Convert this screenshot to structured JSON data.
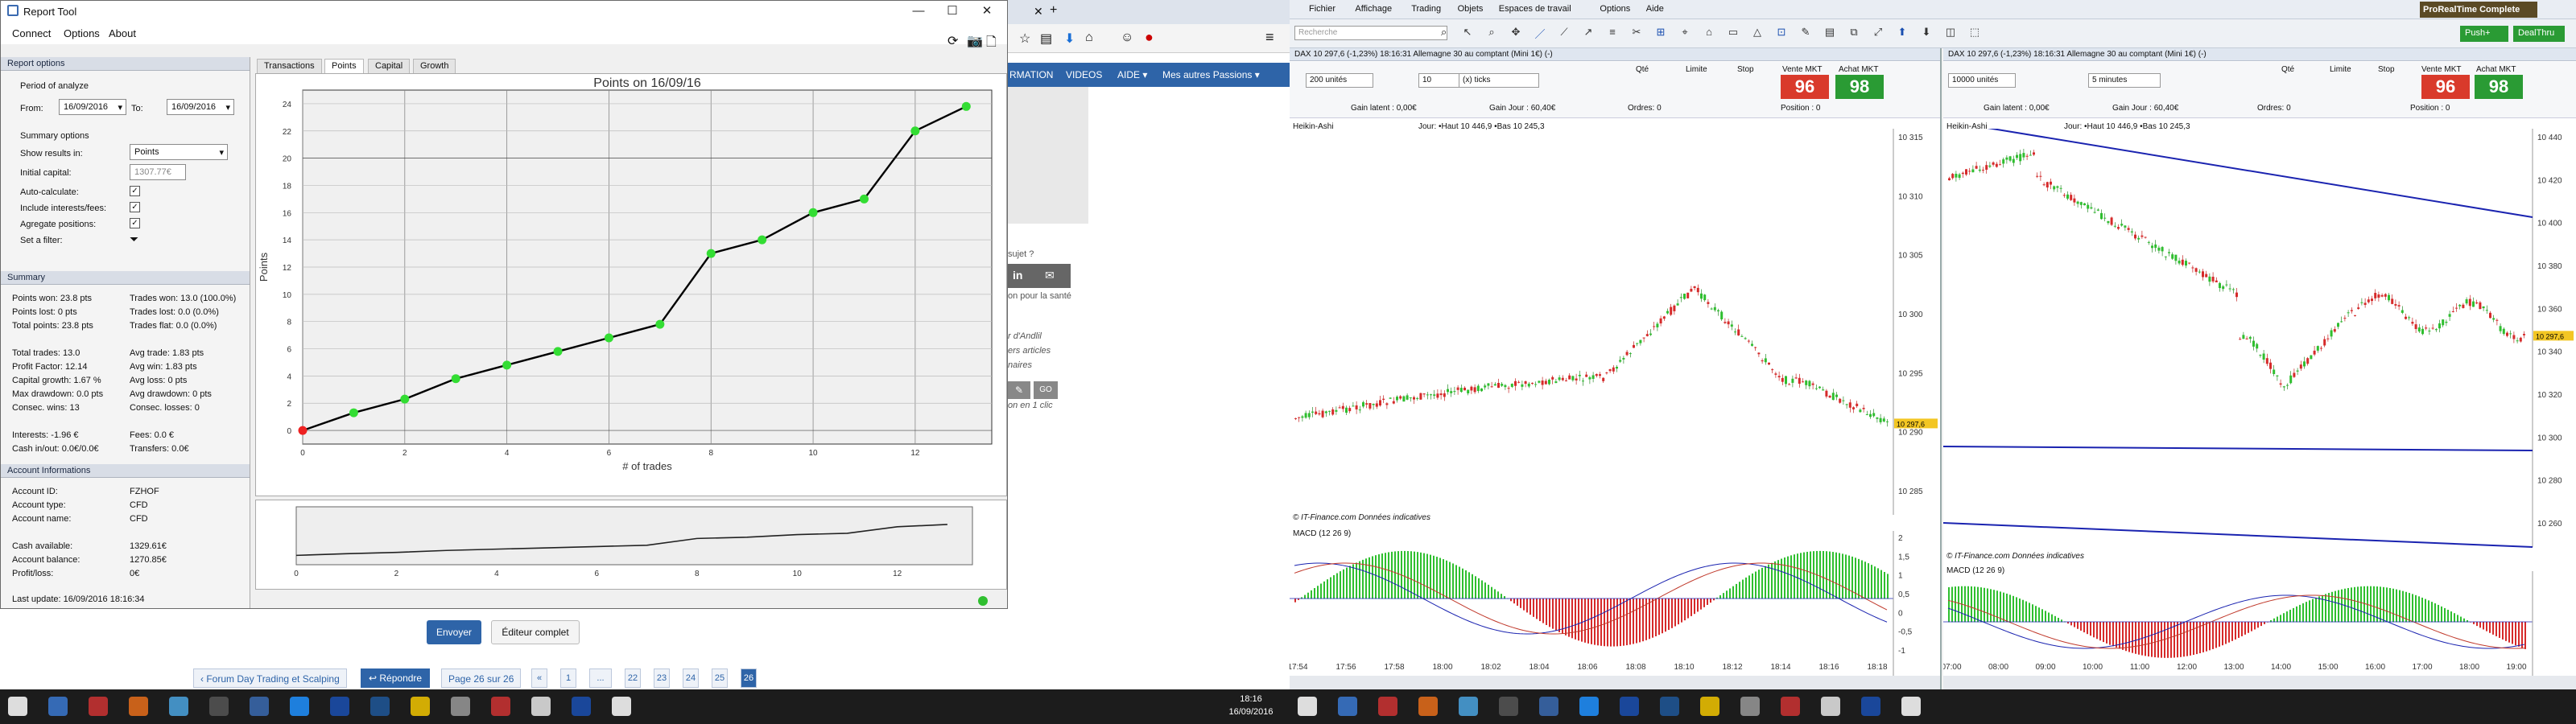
{
  "report": {
    "title": "Report Tool",
    "menu": [
      "Connect",
      "Options",
      "About"
    ],
    "report_options": "Report options",
    "period_label": "Period of analyze",
    "from_label": "From:",
    "from_value": "16/09/2016",
    "to_label": "To:",
    "to_value": "16/09/2016",
    "summary_options": "Summary options",
    "show_results_label": "Show results in:",
    "show_results_value": "Points",
    "initial_capital_label": "Initial capital:",
    "initial_capital_value": "1307.77€",
    "auto_calc": "Auto-calculate:",
    "include_interests": "Include interests/fees:",
    "aggregate": "Agregate positions:",
    "filter": "Set a filter:",
    "summary_title": "Summary",
    "summary_left": [
      "Points won: 23.8 pts",
      "Points lost: 0 pts",
      "Total points: 23.8 pts",
      "",
      "Total trades: 13.0",
      "Profit Factor: 12.14",
      "Capital growth: 1.67 %",
      "Max drawdown: 0.0 pts",
      "Consec. wins: 13",
      "",
      "Interests: -1.96 €",
      "Cash in/out: 0.0€/0.0€"
    ],
    "summary_right": [
      "Trades won: 13.0 (100.0%)",
      "Trades lost: 0.0 (0.0%)",
      "Trades flat: 0.0 (0.0%)",
      "",
      "Avg trade: 1.83 pts",
      "Avg win: 1.83 pts",
      "Avg loss: 0 pts",
      "Avg drawdown: 0 pts",
      "Consec. losses: 0",
      "",
      "Fees: 0.0 €",
      "Transfers: 0.0€"
    ],
    "account_title": "Account Informations",
    "account": [
      [
        "Account ID:",
        "FZHOF"
      ],
      [
        "Account type:",
        "CFD"
      ],
      [
        "Account name:",
        "CFD"
      ],
      [
        "",
        ""
      ],
      [
        "Cash available:",
        "1329.61€"
      ],
      [
        "Account balance:",
        "1270.85€"
      ],
      [
        "Profit/loss:",
        "0€"
      ]
    ],
    "last_update": "Last update: 16/09/2016 18:16:34",
    "tabs": [
      "Transactions",
      "Points",
      "Capital",
      "Growth"
    ],
    "chart_title": "Points on 16/09/16",
    "xlabel": "# of trades",
    "ylabel": "Points"
  },
  "chart_data": {
    "type": "line",
    "title": "Points on 16/09/16",
    "xlabel": "# of trades",
    "ylabel": "Points",
    "x": [
      0,
      1,
      2,
      3,
      4,
      5,
      6,
      7,
      8,
      9,
      10,
      11,
      12,
      13
    ],
    "values": [
      0,
      1.3,
      2.3,
      3.8,
      4.8,
      5.8,
      6.8,
      7.8,
      13,
      14,
      16,
      17,
      22,
      23.8
    ],
    "xlim": [
      0,
      13.5
    ],
    "ylim": [
      -1,
      25
    ],
    "xticks": [
      0,
      2,
      4,
      6,
      8,
      10,
      12
    ],
    "yticks": [
      0,
      2,
      4,
      6,
      8,
      10,
      12,
      14,
      16,
      18,
      20,
      22,
      24
    ],
    "line_color": "#000000",
    "point_color": "#33dd33",
    "first_point_color": "#ee2222"
  },
  "browser": {
    "nav": [
      "RMATION",
      "VIDEOS",
      "AIDE ▾",
      "Mes autres Passions ▾"
    ],
    "texts": [
      "sujet ?",
      "on pour la santé",
      "r d'Andlil",
      "ers articles",
      "naires",
      "on en 1 clic"
    ],
    "send": "Envoyer",
    "editor": "Éditeur complet",
    "forum_link": "Forum Day Trading et Scalping",
    "reply": "Répondre",
    "page_info": "Page 26 sur 26",
    "pages": [
      "«",
      "1",
      "...",
      "22",
      "23",
      "24",
      "25",
      "26"
    ]
  },
  "platform": {
    "menu": [
      "Fichier",
      "Affichage",
      "Trading",
      "Objets",
      "Espaces de travail",
      "Options",
      "Aide"
    ],
    "search": "Recherche",
    "badge": "ProRealTime Complete",
    "push": "Push+",
    "dealthru": "DealThru",
    "left": {
      "header": "DAX  10 297,6 (-1,23%)  18:16:31  Allemagne 30 au comptant (Mini 1€) (-)",
      "units": "200 unités",
      "ticks": "(x) ticks",
      "qty_label": "Qté",
      "limit_label": "Limite",
      "stop_label": "Stop",
      "sell_label": "Vente MKT",
      "buy_label": "Achat MKT",
      "sell": "96",
      "buy": "98",
      "gain_latent": "Gain latent : 0,00€",
      "gain_jour": "Gain Jour : 60,40€",
      "ordres": "Ordres: 0",
      "positions": "Position : 0",
      "chart_label": "Heikin-Ashi",
      "ohlc": "Jour: •Haut 10 446,9 •Bas 10 245,3",
      "source": "© IT-Finance.com  Données indicatives",
      "macd": "MACD (12 26 9)",
      "prices": [
        "10 315",
        "10 310",
        "10 305",
        "10 300",
        "10 295",
        "10 290",
        "10 285"
      ],
      "times": [
        "17:54",
        "17:56",
        "17:58",
        "18:00",
        "18:02",
        "18:04",
        "18:06",
        "18:08",
        "18:10",
        "18:12",
        "18:14",
        "18:16",
        "18:18"
      ],
      "last": "10 297,6",
      "mac": [
        "2",
        "1,5",
        "1",
        "0,5",
        "0",
        "-0,5",
        "-1"
      ]
    },
    "right": {
      "header": "DAX  10 297,6 (-1,23%)  18:16:31  Allemagne 30 au comptant (Mini 1€) (-)",
      "units": "10000 unités",
      "interval": "5 minutes",
      "qty_label": "Qté",
      "limit_label": "Limite",
      "stop_label": "Stop",
      "sell_label": "Vente MKT",
      "buy_label": "Achat MKT",
      "sell": "96",
      "buy": "98",
      "gain_latent": "Gain latent : 0,00€",
      "gain_jour": "Gain Jour : 60,40€",
      "ordres": "Ordres: 0",
      "positions": "Position : 0",
      "chart_label": "Heikin-Ashi",
      "ohlc": "Jour: •Haut 10 446,9 •Bas 10 245,3",
      "source": "© IT-Finance.com  Données indicatives",
      "macd": "MACD (12 26 9)",
      "prices": [
        "10 440",
        "10 420",
        "10 400",
        "10 380",
        "10 360",
        "10 340",
        "10 320",
        "10 300",
        "10 280",
        "10 260"
      ],
      "times": [
        "07:00",
        "08:00",
        "09:00",
        "10:00",
        "11:00",
        "12:00",
        "13:00",
        "14:00",
        "15:00",
        "16:00",
        "17:00",
        "18:00",
        "19:00"
      ],
      "last": "10 297,6"
    }
  },
  "taskbar": {
    "time": "18:16",
    "date": "16/09/2016"
  }
}
